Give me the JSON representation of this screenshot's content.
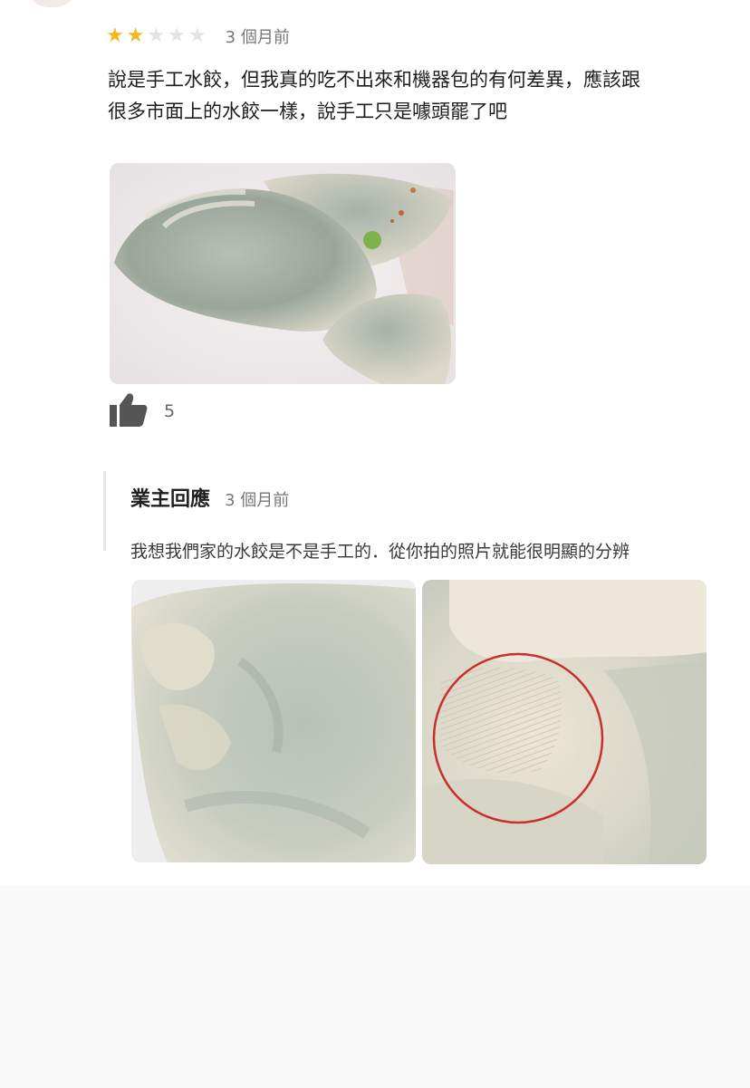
{
  "review": {
    "rating": 2,
    "max_rating": 5,
    "time": "3 個月前",
    "text": "說是手工水餃，但我真的吃不出來和機器包的有何差異，應該跟很多市面上的水餃一樣，說手工只是噱頭罷了吧",
    "like_count": "5"
  },
  "owner_reply": {
    "title": "業主回應",
    "time": "3 個月前",
    "text": "我想我們家的水餃是不是手工的．從你拍的照片就能很明顯的分辨"
  },
  "colors": {
    "star_on": "#f3b81f",
    "star_off": "#e3e3e3",
    "highlight_circle": "#c9302c"
  },
  "icons": [
    "star-icon",
    "thumbs-up-icon"
  ]
}
